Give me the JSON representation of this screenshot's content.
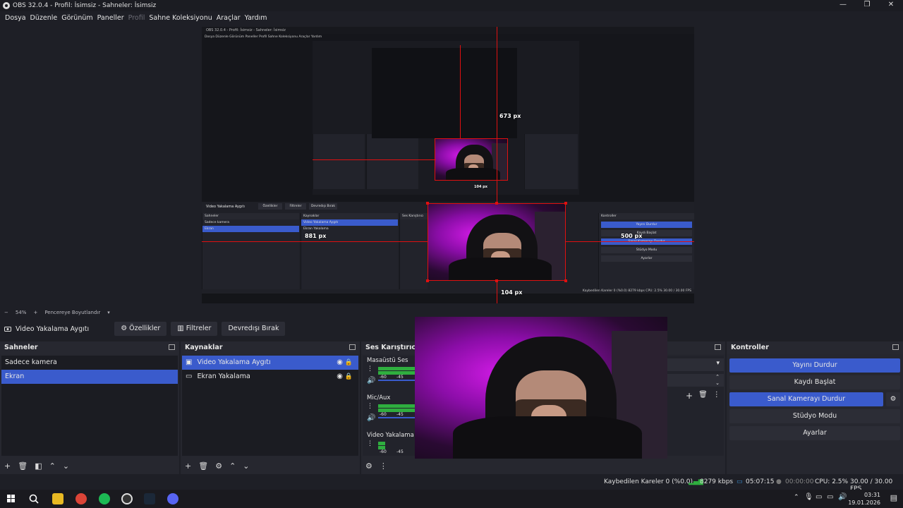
{
  "window": {
    "title": "OBS 32.0.4 - Profil: İsimsiz - Sahneler: İsimsiz",
    "minimize": "—",
    "maximize": "❐",
    "close": "✕"
  },
  "menu": [
    {
      "label": "Dosya",
      "disabled": false
    },
    {
      "label": "Düzenle",
      "disabled": false
    },
    {
      "label": "Görünüm",
      "disabled": false
    },
    {
      "label": "Paneller",
      "disabled": false
    },
    {
      "label": "Profil",
      "disabled": true
    },
    {
      "label": "Sahne Koleksiyonu",
      "disabled": false
    },
    {
      "label": "Araçlar",
      "disabled": false
    },
    {
      "label": "Yardım",
      "disabled": false
    }
  ],
  "preview": {
    "nested_title": "OBS 32.0.4 - Profil: İsimsiz - Sahneler: İsimsiz",
    "nested_menu": "Dosya   Düzenle   Görünüm   Paneller   Profil   Sahne Koleksiyonu   Araçlar   Yardım",
    "measure_labels": {
      "top": "673 px",
      "left": "881 px",
      "right": "500 px",
      "bottom": "104 px",
      "inner_bottom": "104 px"
    },
    "nested_dock": {
      "source_name": "Video Yakalama Aygıtı",
      "buttons": [
        "Özellikler",
        "Filtreler",
        "Devredışı Bırak"
      ],
      "scenes_title": "Sahneler",
      "scenes": [
        "Sadece kamera",
        "Ekran"
      ],
      "sources_title": "Kaynaklar",
      "sources": [
        "Video Yakalama Aygıtı",
        "Ekran Yakalama"
      ],
      "mixer_title": "Ses Karıştırıcı",
      "controls_title": "Kontroller",
      "controls": [
        "Yayını Durdur",
        "Kaydı Başlat",
        "Sanal Kamerayı Durdur",
        "Stüdyo Modu",
        "Ayarlar"
      ],
      "status": "Kaybedilen Kareler 0 (%0.0)   8279 kbps   CPU: 2.5%   30.00 / 30.00 FPS"
    }
  },
  "zoom": {
    "minus": "−",
    "value": "54%",
    "plus": "+",
    "mode": "Pencereye Boyutlandır"
  },
  "source_toolbar": {
    "source_name": "Video Yakalama Aygıtı",
    "properties": "Özellikler",
    "filters": "Filtreler",
    "disable": "Devredışı Bırak"
  },
  "scenes": {
    "title": "Sahneler",
    "items": [
      {
        "label": "Sadece kamera",
        "selected": false
      },
      {
        "label": "Ekran",
        "selected": true
      }
    ]
  },
  "sources": {
    "title": "Kaynaklar",
    "items": [
      {
        "label": "Video Yakalama Aygıtı",
        "icon": "camera-icon",
        "selected": true
      },
      {
        "label": "Ekran Yakalama",
        "icon": "monitor-icon",
        "selected": false
      }
    ]
  },
  "mixer": {
    "title": "Ses Karıştırıcı",
    "channels": [
      {
        "name": "Masaüstü Ses",
        "level": 0.7,
        "tick_a": "-60",
        "tick_b": "-45"
      },
      {
        "name": "Mic/Aux",
        "level": 0.55,
        "tick_a": "-60",
        "tick_b": "-45"
      },
      {
        "name": "Video Yakalama Aygıtı",
        "level": 0.05,
        "tick_a": "-60",
        "tick_b": "-45"
      }
    ]
  },
  "controls": {
    "title": "Kontroller",
    "stop_stream": "Yayını Durdur",
    "start_record": "Kaydı Başlat",
    "stop_virtualcam": "Sanal Kamerayı Durdur",
    "studio_mode": "Stüdyo Modu",
    "settings": "Ayarlar"
  },
  "status": {
    "dropped": "Kaybedilen Kareler 0 (%0.0)",
    "bitrate": "8279 kbps",
    "stream_time": "05:07:15",
    "record_time": "00:00:00",
    "cpu": "CPU: 2.5%",
    "fps": "30.00 / 30.00 FPS"
  },
  "taskbar": {
    "time": "03:31",
    "date": "19.01.2026"
  },
  "colors": {
    "accent": "#3a5bcc",
    "meter": "#2fae3f",
    "guide": "#e01010"
  }
}
